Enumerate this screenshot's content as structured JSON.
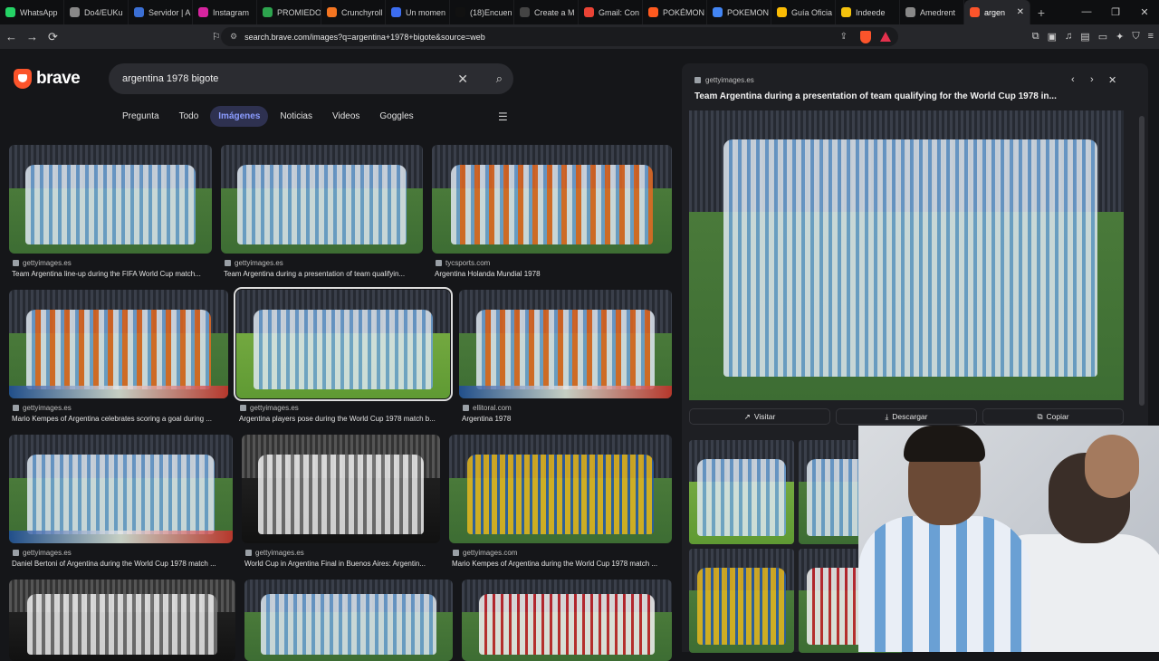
{
  "browser": {
    "tabs": [
      {
        "label": "WhatsApp",
        "color": "#25d366"
      },
      {
        "label": "Do4/EUKu",
        "color": "#888888"
      },
      {
        "label": "Servidor | A",
        "color": "#3b6fd4"
      },
      {
        "label": "Instagram",
        "color": "#d6249f"
      },
      {
        "label": "PROMIEDO",
        "color": "#2da44e"
      },
      {
        "label": "Crunchyroll",
        "color": "#f47521"
      },
      {
        "label": "Un momen",
        "color": "#3c6df0"
      },
      {
        "label": "(18)Encuen",
        "color": "#111111"
      },
      {
        "label": "Create a M",
        "color": "#444444"
      },
      {
        "label": "Gmail: Con",
        "color": "#ea4335"
      },
      {
        "label": "POKÉMON",
        "color": "#ff5a1f"
      },
      {
        "label": "POKEMON",
        "color": "#4285f4"
      },
      {
        "label": "Guía Oficia",
        "color": "#fbbc05"
      },
      {
        "label": "Indeede",
        "color": "#f4c20d"
      },
      {
        "label": "Amedrent",
        "color": "#888888"
      },
      {
        "label": "argen",
        "color": "#fb542b",
        "active": true
      }
    ],
    "url": "search.brave.com/images?q=argentina+1978+bigote&source=web"
  },
  "search": {
    "logo": "brave",
    "query": "argentina 1978 bigote",
    "tabs": [
      "Pregunta",
      "Todo",
      "Imágenes",
      "Noticias",
      "Videos",
      "Goggles"
    ],
    "active_tab": "Imágenes"
  },
  "results": [
    {
      "source": "gettyimages.es",
      "caption": "Team Argentina line-up during the FIFA World Cup match..."
    },
    {
      "source": "gettyimages.es",
      "caption": "Team Argentina during a presentation of team qualifyin..."
    },
    {
      "source": "tycsports.com",
      "caption": "Argentina Holanda Mundial 1978"
    },
    {
      "source": "gettyimages.es",
      "caption": "Mario Kempes of Argentina celebrates scoring a goal during ..."
    },
    {
      "source": "gettyimages.es",
      "caption": "Argentina players pose during the World Cup 1978 match b..."
    },
    {
      "source": "ellitoral.com",
      "caption": "Argentina 1978"
    },
    {
      "source": "gettyimages.es",
      "caption": "Daniel Bertoni of Argentina during the World Cup 1978 match ..."
    },
    {
      "source": "gettyimages.es",
      "caption": "World Cup in Argentina Final in Buenos Aires: Argentin..."
    },
    {
      "source": "gettyimages.com",
      "caption": "Mario Kempes of Argentina during the World Cup 1978 match ..."
    }
  ],
  "detail": {
    "source": "gettyimages.es",
    "title": "Team Argentina during a presentation of team qualifying for the World Cup 1978 in...",
    "buttons": {
      "visit": "Visitar",
      "download": "Descargar",
      "copy": "Copiar"
    }
  },
  "icons": {
    "back": "←",
    "forward": "→",
    "reload": "⟳",
    "close": "✕",
    "search": "⌕",
    "prev": "‹",
    "next": "›"
  }
}
